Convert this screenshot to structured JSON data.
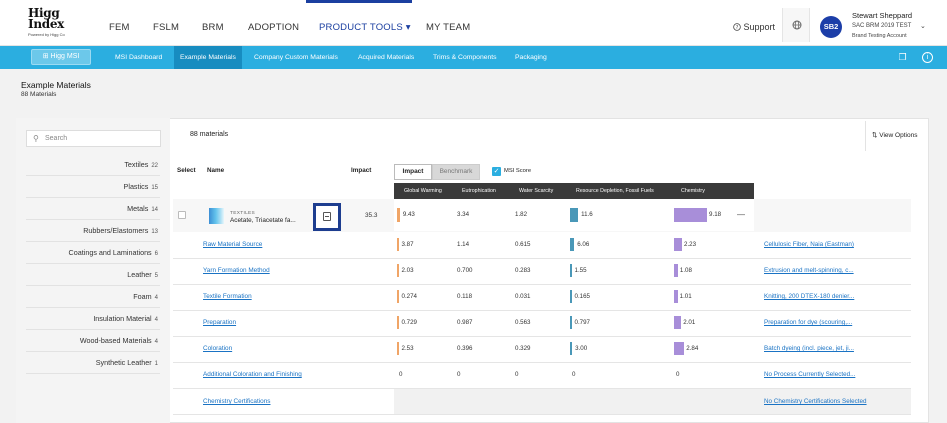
{
  "header": {
    "logo_line1": "Higg",
    "logo_line2": "Index",
    "logo_tag": "Powered by Higg Co",
    "nav": [
      {
        "label": "FEM"
      },
      {
        "label": "FSLM"
      },
      {
        "label": "BRM"
      },
      {
        "label": "ADOPTION"
      },
      {
        "label": "PRODUCT TOOLS ▾",
        "active": true
      },
      {
        "label": "MY TEAM"
      }
    ],
    "support_label": "Support",
    "user": {
      "initials": "SB2",
      "name": "Stewart Sheppard",
      "org": "SAC BRM 2019 TEST",
      "account": "Brand Testing Account"
    }
  },
  "subnav": {
    "home_label": "Higg MSI",
    "items": [
      {
        "label": "MSI Dashboard"
      },
      {
        "label": "Example Materials",
        "active": true
      },
      {
        "label": "Company Custom Materials"
      },
      {
        "label": "Acquired Materials"
      },
      {
        "label": "Trims & Components"
      },
      {
        "label": "Packaging"
      }
    ]
  },
  "page": {
    "title": "Example Materials",
    "subtitle": "88 Materials"
  },
  "sidebar": {
    "search_placeholder": "Search",
    "categories": [
      {
        "label": "Textiles",
        "count": "22"
      },
      {
        "label": "Plastics",
        "count": "15"
      },
      {
        "label": "Metals",
        "count": "14"
      },
      {
        "label": "Rubbers/Elastomers",
        "count": "13"
      },
      {
        "label": "Coatings and Laminations",
        "count": "6"
      },
      {
        "label": "Leather",
        "count": "5"
      },
      {
        "label": "Foam",
        "count": "4"
      },
      {
        "label": "Insulation Material",
        "count": "4"
      },
      {
        "label": "Wood-based Materials",
        "count": "4"
      },
      {
        "label": "Synthetic Leather",
        "count": "1"
      }
    ]
  },
  "table": {
    "count_label": "88 materials",
    "view_options": "View Options",
    "headers": {
      "select": "Select",
      "name": "Name",
      "impact": "Impact"
    },
    "tabs": {
      "impact": "Impact",
      "benchmark": "Benchmark"
    },
    "msi_score_label": "MSI Score",
    "metric_columns": [
      "Global Warming",
      "Eutrophication",
      "Water Scarcity",
      "Resource Depletion, Fossil Fuels",
      "Chemistry"
    ],
    "material": {
      "tag": "TEXTILES",
      "name": "Acetate, Triacetate fa...",
      "impact": "35.3",
      "values": [
        "9.43",
        "3.34",
        "1.82",
        "11.6",
        "9.18"
      ],
      "more": "—"
    },
    "processes": [
      {
        "name": "Raw Material Source",
        "values": [
          "3.87",
          "1.14",
          "0.615",
          "6.06",
          "2.23"
        ],
        "detail": "Cellulosic Fiber, Naia (Eastman)"
      },
      {
        "name": "Yarn Formation Method",
        "values": [
          "2.03",
          "0.700",
          "0.283",
          "1.55",
          "1.08"
        ],
        "detail": "Extrusion and melt-spinning, c..."
      },
      {
        "name": "Textile Formation",
        "values": [
          "0.274",
          "0.118",
          "0.031",
          "0.165",
          "1.01"
        ],
        "detail": "Knitting, 200 DTEX-180 denier..."
      },
      {
        "name": "Preparation",
        "values": [
          "0.729",
          "0.987",
          "0.563",
          "0.797",
          "2.01"
        ],
        "detail": "Preparation for dye (scouring,..."
      },
      {
        "name": "Coloration",
        "values": [
          "2.53",
          "0.396",
          "0.329",
          "3.00",
          "2.84"
        ],
        "detail": "Batch dyeing (incl. piece, jet, ji..."
      },
      {
        "name": "Additional Coloration and Finishing",
        "values": [
          "0",
          "0",
          "0",
          "0",
          "0"
        ],
        "detail": "No Process Currently Selected..."
      },
      {
        "name": "Chemistry Certifications",
        "values": [],
        "detail": "No Chemistry Certifications Selected"
      }
    ]
  },
  "colors": {
    "nav_blue": "#1b3fa0",
    "subnav_blue": "#2baee0",
    "global_warming_bar": "#f0a567",
    "water_bar": "#4a98b8",
    "chemistry_bar": "#a88ed9",
    "link": "#1a73c4"
  }
}
